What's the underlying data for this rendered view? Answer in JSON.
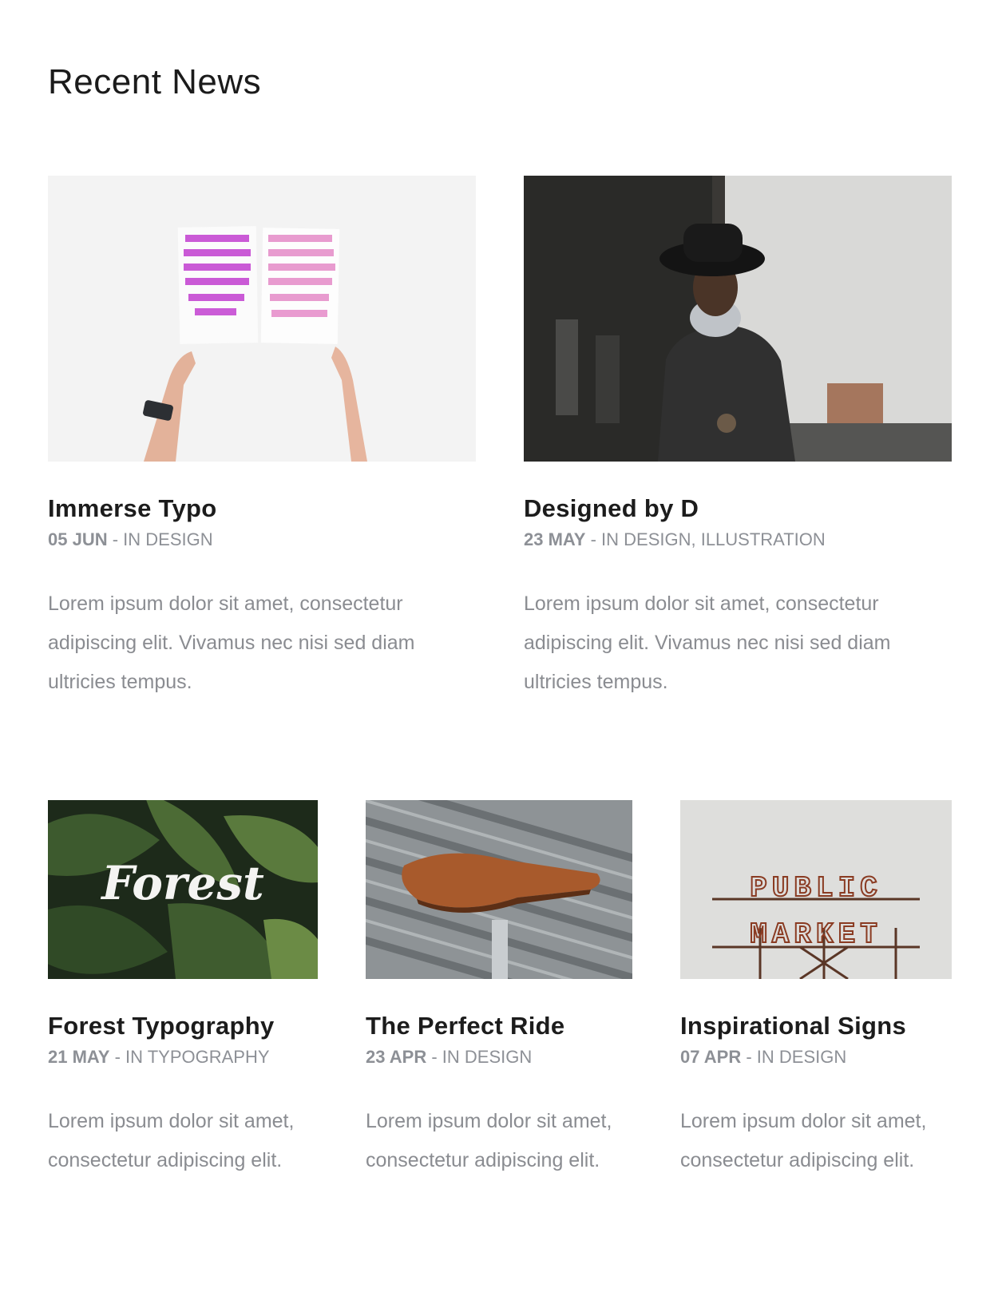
{
  "section": {
    "title": "Recent News"
  },
  "posts": [
    {
      "title": "Immerse Typo",
      "date": "05 JUN",
      "separator": " - ",
      "categories": "IN DESIGN",
      "excerpt": "Lorem ipsum dolor sit amet, consectetur adipiscing elit. Vivamus nec nisi sed diam ultricies tempus.",
      "image": "hands-holding-typography-poster"
    },
    {
      "title": "Designed by D",
      "date": "23 MAY",
      "separator": " - ",
      "categories": "IN DESIGN, ILLUSTRATION",
      "excerpt": "Lorem ipsum dolor sit amet, consectetur adipiscing elit. Vivamus nec nisi sed diam ultricies tempus.",
      "image": "man-in-black-hat"
    },
    {
      "title": "Forest Typography",
      "date": "21 MAY",
      "separator": " - ",
      "categories": "IN TYPOGRAPHY",
      "excerpt": "Lorem ipsum dolor sit amet, consectetur adipiscing elit.",
      "image": "forest-lettering-on-leaves",
      "image_text": "Forest"
    },
    {
      "title": "The Perfect Ride",
      "date": "23 APR",
      "separator": " - ",
      "categories": "IN DESIGN",
      "excerpt": "Lorem ipsum dolor sit amet, consectetur adipiscing elit.",
      "image": "leather-bicycle-saddle"
    },
    {
      "title": "Inspirational Signs",
      "date": "07 APR",
      "separator": " - ",
      "categories": "IN DESIGN",
      "excerpt": "Lorem ipsum dolor sit amet, consectetur adipiscing elit.",
      "image": "public-market-sign",
      "image_text": [
        "PUBLIC",
        "MARKET"
      ]
    }
  ],
  "colors": {
    "heading": "#1b1b1b",
    "meta": "#8d9096",
    "excerpt": "#8a8c91",
    "background": "#ffffff"
  }
}
